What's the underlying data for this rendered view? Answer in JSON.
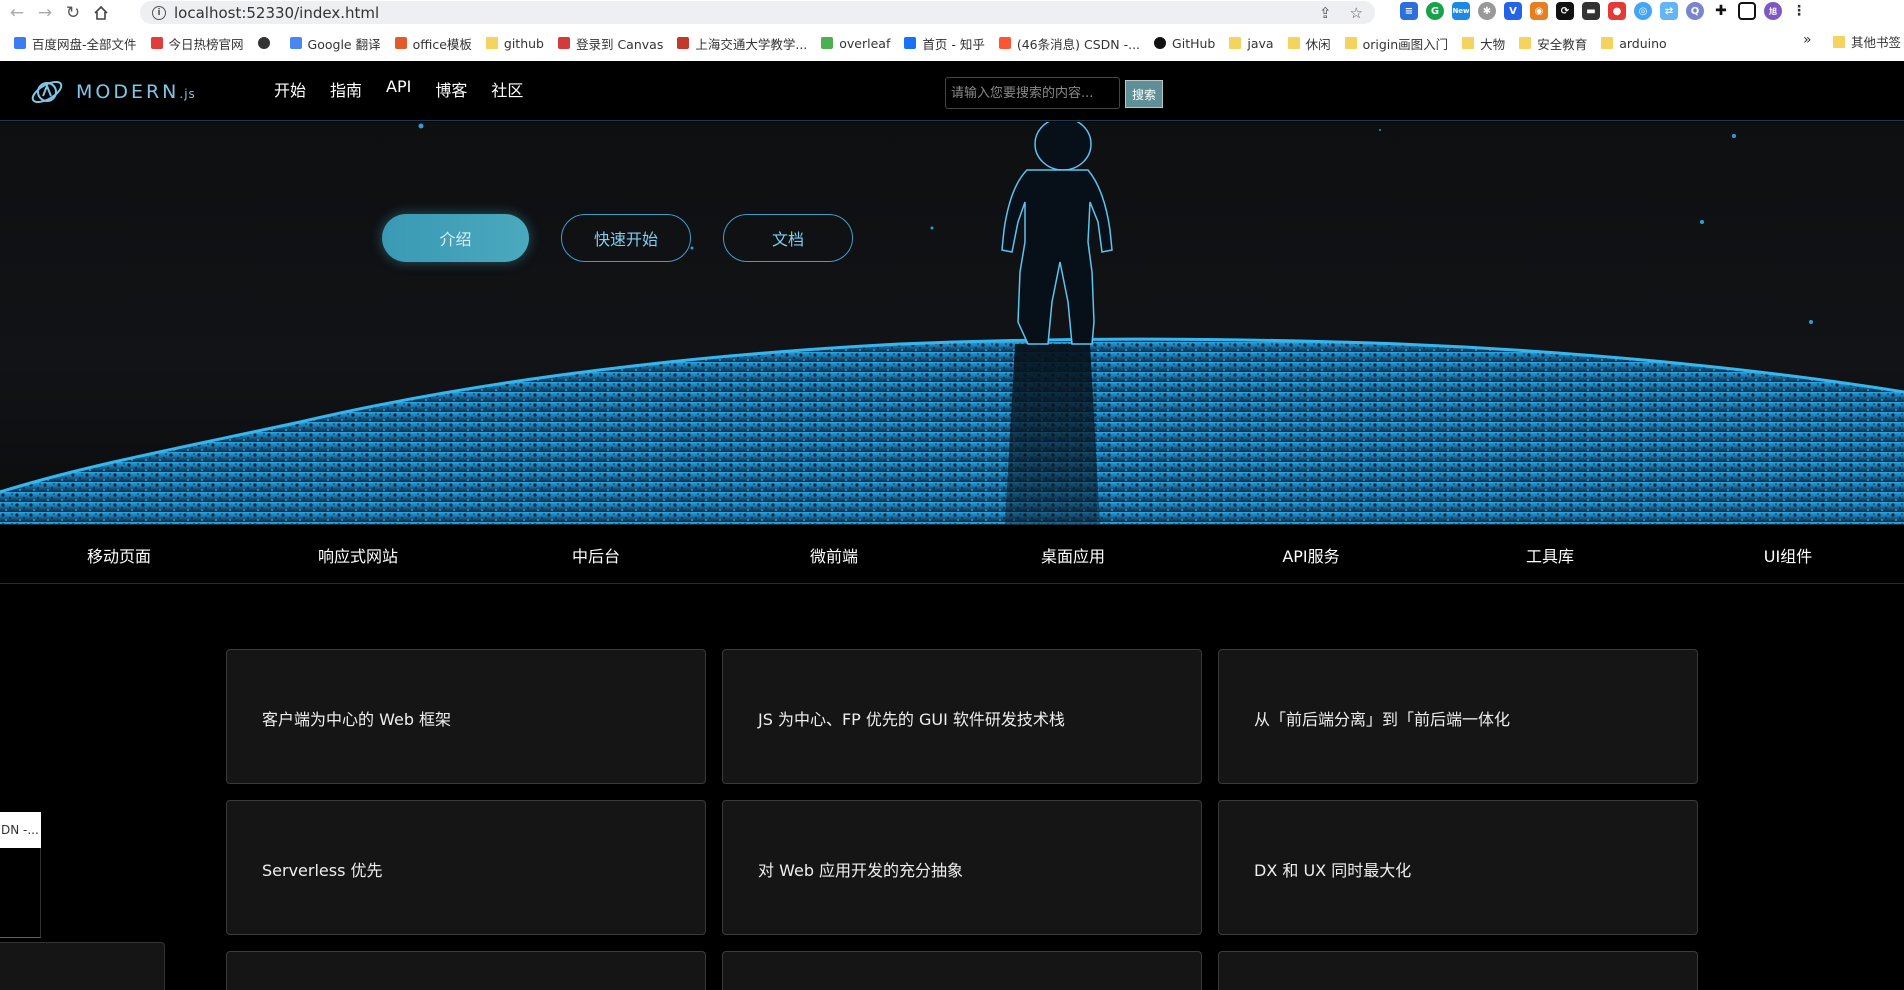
{
  "browser": {
    "url": "localhost:52330/index.html",
    "bookmarks": [
      {
        "label": "百度网盘-全部文件",
        "icon": "baidu-netdisk-icon",
        "color": "#3b7cf0"
      },
      {
        "label": "今日热榜官网",
        "icon": "r-icon",
        "color": "#e23b3b"
      },
      {
        "label": "",
        "icon": "globe-icon",
        "color": "#333333"
      },
      {
        "label": "Google 翻译",
        "icon": "google-translate-icon",
        "color": "#4a86f0"
      },
      {
        "label": "office模板",
        "icon": "office-icon",
        "color": "#e45b2b"
      },
      {
        "label": "github",
        "icon": "folder-icon",
        "color": "#f4d35e"
      },
      {
        "label": "登录到 Canvas",
        "icon": "canvas-icon",
        "color": "#d33b3b"
      },
      {
        "label": "上海交通大学教学...",
        "icon": "sjtu-icon",
        "color": "#c0392b"
      },
      {
        "label": "overleaf",
        "icon": "overleaf-icon",
        "color": "#4caf50"
      },
      {
        "label": "首页 - 知乎",
        "icon": "zhihu-icon",
        "color": "#1772f6"
      },
      {
        "label": "(46条消息) CSDN -...",
        "icon": "csdn-icon",
        "color": "#fc5531"
      },
      {
        "label": "GitHub",
        "icon": "github-icon",
        "color": "#111111"
      },
      {
        "label": "java",
        "icon": "folder-icon",
        "color": "#f4d35e"
      },
      {
        "label": "休闲",
        "icon": "folder-icon",
        "color": "#f4d35e"
      },
      {
        "label": "origin画图入门",
        "icon": "folder-icon",
        "color": "#f4d35e"
      },
      {
        "label": "大物",
        "icon": "folder-icon",
        "color": "#f4d35e"
      },
      {
        "label": "安全教育",
        "icon": "folder-icon",
        "color": "#f4d35e"
      },
      {
        "label": "arduino",
        "icon": "folder-icon",
        "color": "#f4d35e"
      }
    ],
    "bookmarks_overflow": "»",
    "other_bookmarks": "其他书签"
  },
  "header": {
    "logo_text": "MODERN",
    "logo_suffix": ".js",
    "nav": [
      "开始",
      "指南",
      "API",
      "博客",
      "社区"
    ],
    "search_placeholder": "请输入您要搜索的内容...",
    "search_button": "搜索"
  },
  "hero": {
    "buttons": [
      "介绍",
      "快速开始",
      "文档"
    ],
    "accent_color": "#2a9fd6"
  },
  "categories": [
    "移动页面",
    "响应式网站",
    "中后台",
    "微前端",
    "桌面应用",
    "API服务",
    "工具库",
    "UI组件"
  ],
  "cards": [
    "客户端为中心的 Web 框架",
    "JS 为中心、FP 优先的 GUI 软件研发技术栈",
    "从「前后端分离」到「前后端一体化",
    "Serverless 优先",
    "对 Web 应用开发的充分抽象",
    "DX 和 UX 同时最大化",
    "",
    "",
    ""
  ],
  "overlay": {
    "tooltip_text": "DN -..."
  }
}
